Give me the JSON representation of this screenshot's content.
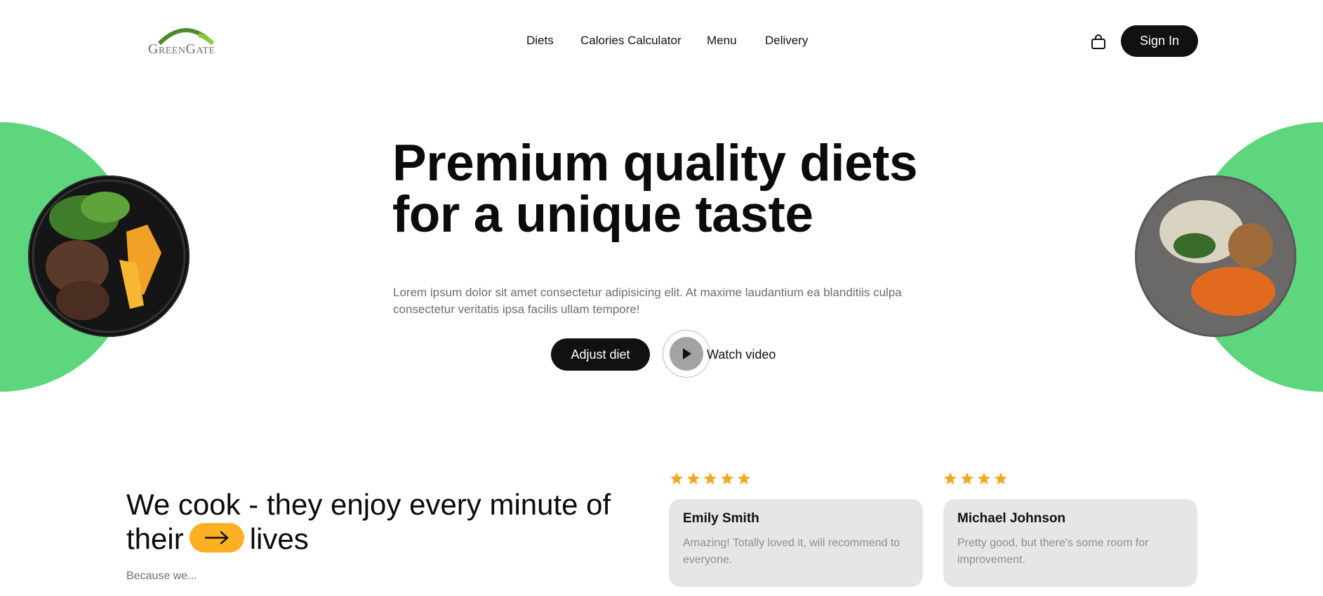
{
  "brand": {
    "name": "GreenGate",
    "arc_color": "#4c8a2c"
  },
  "nav": {
    "items": [
      {
        "label": "Diets"
      },
      {
        "label": "Calories Calculator"
      },
      {
        "label": "Menu"
      },
      {
        "label": "Delivery"
      }
    ],
    "cart_icon": "shopping-bag-icon",
    "signin_label": "Sign In"
  },
  "hero": {
    "title_line1": "Premium quality diets",
    "title_line2": "for a unique taste",
    "description": "Lorem ipsum dolor sit amet consectetur adipisicing elit. At maxime laudantium ea blanditiis culpa consectetur veritatis ipsa facilis ullam tempore!",
    "cta_label": "Adjust diet",
    "video_label": "Watch video",
    "accent_color": "#5dd67d"
  },
  "section": {
    "title_part1": "We cook - they enjoy every minute of",
    "title_part2": "their",
    "title_part3": "lives",
    "subtitle": "Because we...",
    "arrow_icon": "arrow-right-icon",
    "pill_color": "#fdb022"
  },
  "reviews": [
    {
      "stars": 5,
      "name": "Emily Smith",
      "text": "Amazing! Totally loved it, will recommend to everyone."
    },
    {
      "stars": 4,
      "name": "Michael Johnson",
      "text": "Pretty good, but there's some room for improvement."
    }
  ],
  "colors": {
    "dark": "#111111",
    "star": "#f5a623",
    "card": "#e6e6e6"
  }
}
